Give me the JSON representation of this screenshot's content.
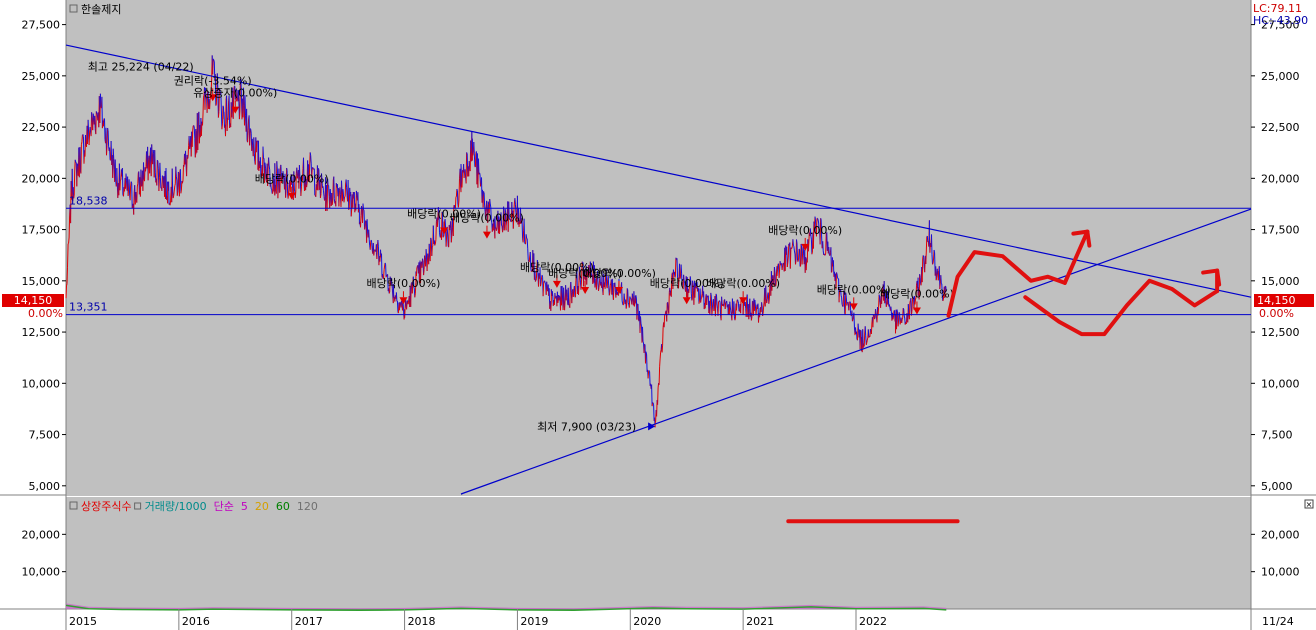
{
  "stock_name": "한솔제지",
  "lc_label": "LC:79.11",
  "hc_label": "HC:-43.90",
  "end_label": "11/24",
  "close_icon": "close-icon",
  "colors": {
    "up": "#e00000",
    "down": "#1010e0",
    "trend": "#0000cc",
    "drawing": "#e01010",
    "price_tag_bg": "#e00000",
    "plot_bg": "#c0c0c0"
  },
  "chart_data": {
    "type": "line",
    "x_axis": {
      "labels": [
        "2015",
        "2016",
        "2017",
        "2018",
        "2019",
        "2020",
        "2021",
        "2022"
      ],
      "range_years": [
        2015.0,
        2025.5
      ]
    },
    "price_axis": {
      "range": [
        4600,
        28700
      ],
      "ticks": [
        5000,
        7500,
        10000,
        12500,
        15000,
        17500,
        20000,
        22500,
        25000,
        27500
      ],
      "tick_labels": [
        "5,000",
        "7,500",
        "10,000",
        "12,500",
        "15,000",
        "17,500",
        "20,000",
        "22,500",
        "25,000",
        "27,500"
      ]
    },
    "volume_axis": {
      "range": [
        0,
        30000
      ],
      "ticks": [
        10000,
        20000
      ],
      "tick_labels": [
        "10,000",
        "20,000"
      ]
    },
    "current_price": {
      "value": 14150,
      "label": "14,150",
      "pct_label": "0.00%"
    },
    "high": {
      "label": "최고 25,224 (04/22)",
      "t": 2016.3,
      "value": 25224
    },
    "low": {
      "label": "최저 7,900 (03/23)",
      "t": 2020.22,
      "value": 7900
    },
    "horizontal_lines": [
      {
        "value": 18538,
        "label": "18,538"
      },
      {
        "value": 13351,
        "label": "13,351"
      }
    ],
    "trend_lines": [
      {
        "from": {
          "t": 2015.0,
          "v": 26500
        },
        "to": {
          "t": 2025.5,
          "v": 14200
        }
      },
      {
        "from": {
          "t": 2018.5,
          "v": 4600
        },
        "to": {
          "t": 2025.5,
          "v": 18500
        }
      }
    ],
    "price_series": {
      "name": "한솔제지",
      "points": [
        [
          2015.0,
          14150
        ],
        [
          2015.05,
          19500
        ],
        [
          2015.15,
          21500
        ],
        [
          2015.3,
          23500
        ],
        [
          2015.45,
          20000
        ],
        [
          2015.6,
          19000
        ],
        [
          2015.75,
          21000
        ],
        [
          2015.9,
          19500
        ],
        [
          2016.0,
          19800
        ],
        [
          2016.15,
          22000
        ],
        [
          2016.3,
          25000
        ],
        [
          2016.4,
          23000
        ],
        [
          2016.55,
          23800
        ],
        [
          2016.7,
          21000
        ],
        [
          2016.85,
          20000
        ],
        [
          2017.0,
          19500
        ],
        [
          2017.15,
          20500
        ],
        [
          2017.3,
          19200
        ],
        [
          2017.45,
          19500
        ],
        [
          2017.6,
          18500
        ],
        [
          2017.75,
          16500
        ],
        [
          2017.9,
          14500
        ],
        [
          2018.0,
          13500
        ],
        [
          2018.1,
          15000
        ],
        [
          2018.2,
          16000
        ],
        [
          2018.3,
          18000
        ],
        [
          2018.4,
          17000
        ],
        [
          2018.5,
          20000
        ],
        [
          2018.6,
          21500
        ],
        [
          2018.7,
          19000
        ],
        [
          2018.8,
          17500
        ],
        [
          2018.9,
          18000
        ],
        [
          2019.0,
          18500
        ],
        [
          2019.1,
          16500
        ],
        [
          2019.2,
          15000
        ],
        [
          2019.3,
          14000
        ],
        [
          2019.45,
          14200
        ],
        [
          2019.6,
          15500
        ],
        [
          2019.75,
          15000
        ],
        [
          2019.9,
          14500
        ],
        [
          2020.05,
          14000
        ],
        [
          2020.18,
          10000
        ],
        [
          2020.22,
          7900
        ],
        [
          2020.3,
          13000
        ],
        [
          2020.4,
          15500
        ],
        [
          2020.55,
          14500
        ],
        [
          2020.7,
          14000
        ],
        [
          2020.85,
          13500
        ],
        [
          2021.0,
          13800
        ],
        [
          2021.15,
          13500
        ],
        [
          2021.3,
          15500
        ],
        [
          2021.45,
          16500
        ],
        [
          2021.55,
          16000
        ],
        [
          2021.65,
          17800
        ],
        [
          2021.75,
          16500
        ],
        [
          2021.85,
          14500
        ],
        [
          2021.95,
          13500
        ],
        [
          2022.05,
          12000
        ],
        [
          2022.15,
          13000
        ],
        [
          2022.25,
          14500
        ],
        [
          2022.35,
          13000
        ],
        [
          2022.45,
          13200
        ],
        [
          2022.55,
          14500
        ],
        [
          2022.65,
          17200
        ],
        [
          2022.72,
          15500
        ],
        [
          2022.8,
          14150
        ]
      ]
    },
    "events": [
      {
        "label": "권리락(-3.54%)",
        "t": 2016.3,
        "v": 24100
      },
      {
        "label": "유상증자(0.00%)",
        "t": 2016.5,
        "v": 23500
      },
      {
        "label": "배당락(0.00%)",
        "t": 2017.0,
        "v": 19300
      },
      {
        "label": "배당락(0.00%)",
        "t": 2017.99,
        "v": 14200
      },
      {
        "label": "배당락(0.00%)",
        "t": 2018.35,
        "v": 17600
      },
      {
        "label": "배당락(0.00%)",
        "t": 2018.73,
        "v": 17400
      },
      {
        "label": "배당락(0.00%)",
        "t": 2019.35,
        "v": 15000
      },
      {
        "label": "배당락(0.00%)",
        "t": 2019.6,
        "v": 14700
      },
      {
        "label": "배당락(0.00%)",
        "t": 2019.9,
        "v": 14700
      },
      {
        "label": "배당락(0.00%)",
        "t": 2020.5,
        "v": 14200
      },
      {
        "label": "배당락(0.00%)",
        "t": 2021.0,
        "v": 14200
      },
      {
        "label": "배당락(0.00%)",
        "t": 2021.55,
        "v": 16800
      },
      {
        "label": "배당락(0.00%)",
        "t": 2021.98,
        "v": 13900
      },
      {
        "label": "배당락(0.00%)",
        "t": 2022.54,
        "v": 13700
      }
    ],
    "volume_legend": [
      {
        "label": "상장주식수",
        "color": "#e00000"
      },
      {
        "label": "거래량/1000",
        "color": "#008b8b"
      },
      {
        "label": "단순",
        "color": "#c000c0"
      },
      {
        "label": "5",
        "color": "#c000c0"
      },
      {
        "label": "20",
        "color": "#d4a000"
      },
      {
        "label": "60",
        "color": "#008000"
      },
      {
        "label": "120",
        "color": "#707070"
      }
    ],
    "volume_series": {
      "points": [
        [
          2015.0,
          1500
        ],
        [
          2015.2,
          600
        ],
        [
          2015.5,
          400
        ],
        [
          2016.0,
          300
        ],
        [
          2016.3,
          500
        ],
        [
          2017.0,
          300
        ],
        [
          2017.6,
          200
        ],
        [
          2018.0,
          300
        ],
        [
          2018.5,
          700
        ],
        [
          2019.0,
          300
        ],
        [
          2019.5,
          200
        ],
        [
          2020.2,
          800
        ],
        [
          2020.5,
          600
        ],
        [
          2021.0,
          500
        ],
        [
          2021.6,
          1100
        ],
        [
          2022.0,
          600
        ],
        [
          2022.6,
          700
        ],
        [
          2022.8,
          300
        ]
      ]
    }
  },
  "drawings": {
    "squiggle_1": [
      [
        2022.82,
        13300
      ],
      [
        2022.9,
        15200
      ],
      [
        2023.05,
        16400
      ],
      [
        2023.3,
        16200
      ],
      [
        2023.55,
        15000
      ],
      [
        2023.7,
        15200
      ],
      [
        2023.85,
        14900
      ]
    ],
    "squiggle_1_arrow": [
      [
        2023.85,
        14900
      ],
      [
        2024.05,
        17400
      ]
    ],
    "squiggle_2": [
      [
        2023.5,
        14200
      ],
      [
        2023.8,
        13000
      ],
      [
        2024.0,
        12400
      ],
      [
        2024.2,
        12400
      ],
      [
        2024.4,
        13800
      ],
      [
        2024.6,
        15000
      ],
      [
        2024.8,
        14600
      ],
      [
        2025.0,
        13800
      ],
      [
        2025.2,
        14500
      ]
    ],
    "squiggle_2_arrow": [
      [
        2025.2,
        14500
      ],
      [
        2025.2,
        15500
      ]
    ],
    "volume_mark": {
      "t1": 2021.4,
      "t2": 2022.9,
      "v": 23500
    }
  }
}
